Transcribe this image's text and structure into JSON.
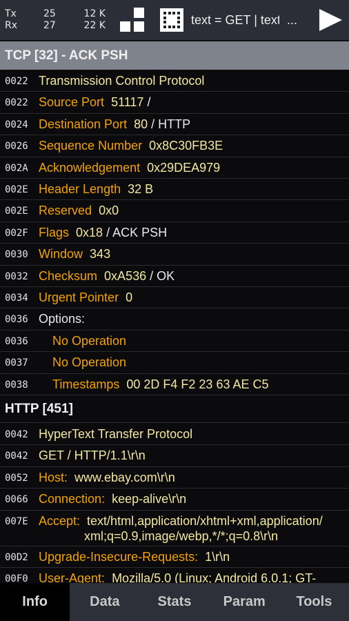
{
  "topbar": {
    "tx_label": "Tx",
    "tx_packets": "25",
    "tx_bytes": "12 K",
    "rx_label": "Rx",
    "rx_packets": "27",
    "rx_bytes": "22 K",
    "filter": "text = GET | text",
    "more": "...",
    "icons": [
      "layout-blocks-icon",
      "grid-icon",
      "play-icon"
    ]
  },
  "tcp": {
    "title": "TCP [32] - ACK PSH",
    "rows": [
      {
        "off": "0022",
        "val": "Transmission Control Protocol"
      },
      {
        "off": "0022",
        "name": "Source Port",
        "val": "51117",
        "ex": "/"
      },
      {
        "off": "0024",
        "name": "Destination Port",
        "val": "80",
        "ex": "/ HTTP"
      },
      {
        "off": "0026",
        "name": "Sequence Number",
        "val": "0x8C30FB3E"
      },
      {
        "off": "002A",
        "name": "Acknowledgement",
        "val": "0x29DEA979"
      },
      {
        "off": "002E",
        "name": "Header Length",
        "val": "32 B"
      },
      {
        "off": "002E",
        "name": "Reserved",
        "val": "0x0"
      },
      {
        "off": "002F",
        "name": "Flags",
        "val": "0x18",
        "ex": "/ ACK PSH"
      },
      {
        "off": "0030",
        "name": "Window",
        "val": "343"
      },
      {
        "off": "0032",
        "name": "Checksum",
        "val": "0xA536",
        "ex": "/ OK"
      },
      {
        "off": "0034",
        "name": "Urgent Pointer",
        "val": "0"
      },
      {
        "off": "0036",
        "ex": "Options:"
      },
      {
        "off": "0036",
        "name": "No Operation",
        "indent": true
      },
      {
        "off": "0037",
        "name": "No Operation",
        "indent": true
      },
      {
        "off": "0038",
        "name": "Timestamps",
        "val": "00 2D F4 F2 23 63 AE C5",
        "indent": true
      }
    ]
  },
  "http": {
    "title": "HTTP [451]",
    "rows": [
      {
        "off": "0042",
        "val": "HyperText Transfer Protocol"
      },
      {
        "off": "0042",
        "val": "GET / HTTP/1.1\\r\\n"
      },
      {
        "off": "0052",
        "name": "Host:",
        "val": "www.ebay.com\\r\\n"
      },
      {
        "off": "0066",
        "name": "Connection:",
        "val": "keep-alive\\r\\n"
      },
      {
        "off": "007E",
        "name": "Accept:",
        "val": "text/html,application/xhtml+xml,application/",
        "val2": "xml;q=0.9,image/webp,*/*;q=0.8\\r\\n"
      },
      {
        "off": "00D2",
        "name": "Upgrade-Insecure-Requests:",
        "val": "1\\r\\n"
      },
      {
        "off": "00F0",
        "name": "User-Agent:",
        "val": "Mozilla/5.0 (Linux; Android 6.0.1; GT-"
      }
    ]
  },
  "tabs": [
    {
      "label": "Info",
      "active": true
    },
    {
      "label": "Data"
    },
    {
      "label": "Stats"
    },
    {
      "label": "Param"
    },
    {
      "label": "Tools"
    }
  ],
  "colors": {
    "field_name": "#f4a300",
    "field_value": "#f3e8a0",
    "section_bg": "#7f838c",
    "toolbar_bg": "#2b2e37"
  }
}
